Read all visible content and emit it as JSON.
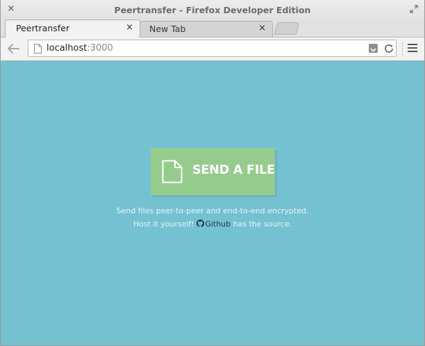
{
  "window": {
    "title": "Peertransfer - Firefox Developer Edition",
    "close_glyph": "×"
  },
  "tabs": [
    {
      "label": "Peertransfer",
      "close_glyph": "×",
      "active": true
    },
    {
      "label": "New Tab",
      "close_glyph": "×",
      "active": false
    }
  ],
  "navbar": {
    "url_host": "localhost",
    "url_port": ":3000"
  },
  "page": {
    "send_button_label": "SEND A FILE",
    "description_line1": "Send files peer-to-peer and end-to-end encrypted.",
    "description_line2_prefix": "Host it yourself!",
    "github_link_label": "Github",
    "description_line2_suffix": "has the source."
  },
  "icons": {
    "back": "back-arrow-icon",
    "page": "page-icon",
    "reload": "reload-icon",
    "menu": "hamburger-menu-icon",
    "file": "file-icon",
    "github": "github-icon"
  },
  "colors": {
    "page_background": "#74c1d2",
    "send_button": "#95cc8c",
    "text_light": "#e8f5f8",
    "link": "#1f3a44"
  }
}
